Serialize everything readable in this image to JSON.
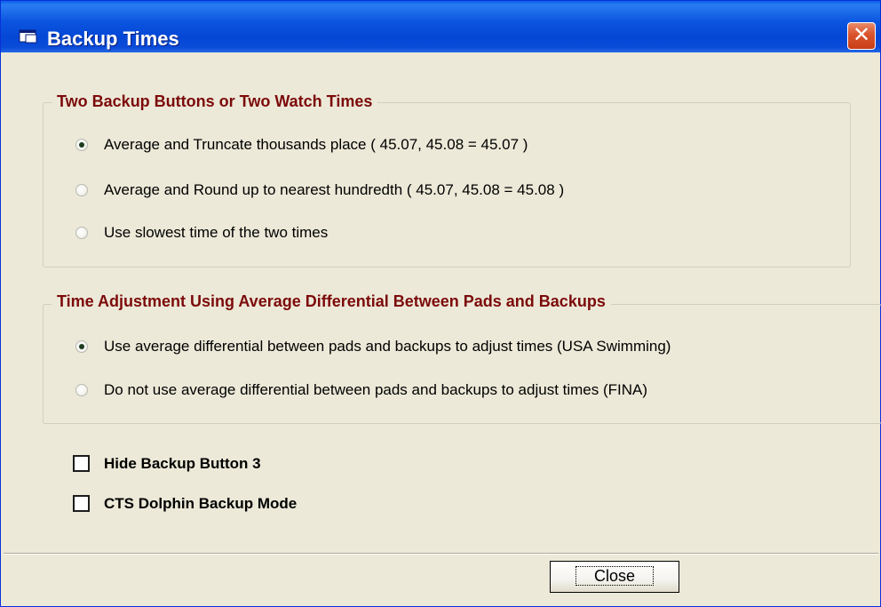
{
  "window": {
    "title": "Backup Times",
    "close_glyph": "✕"
  },
  "group1": {
    "legend": "Two Backup Buttons or Two Watch Times",
    "options": [
      {
        "label": "Average and Truncate thousands place  ( 45.07, 45.08 = 45.07 )",
        "selected": true
      },
      {
        "label": "Average and Round up to nearest hundredth  ( 45.07, 45.08 = 45.08 )",
        "selected": false
      },
      {
        "label": "Use slowest time of the two times",
        "selected": false
      }
    ]
  },
  "group2": {
    "legend": "Time Adjustment Using Average Differential Between Pads and Backups",
    "options": [
      {
        "label": "Use average differential between pads and backups to adjust times (USA Swimming)",
        "selected": true
      },
      {
        "label": "Do not use average differential between pads and backups to adjust times (FINA)",
        "selected": false
      }
    ]
  },
  "checkboxes": [
    {
      "label": "Hide Backup Button 3",
      "checked": false
    },
    {
      "label": "CTS Dolphin Backup Mode",
      "checked": false
    }
  ],
  "buttons": {
    "close_label": "Close"
  }
}
